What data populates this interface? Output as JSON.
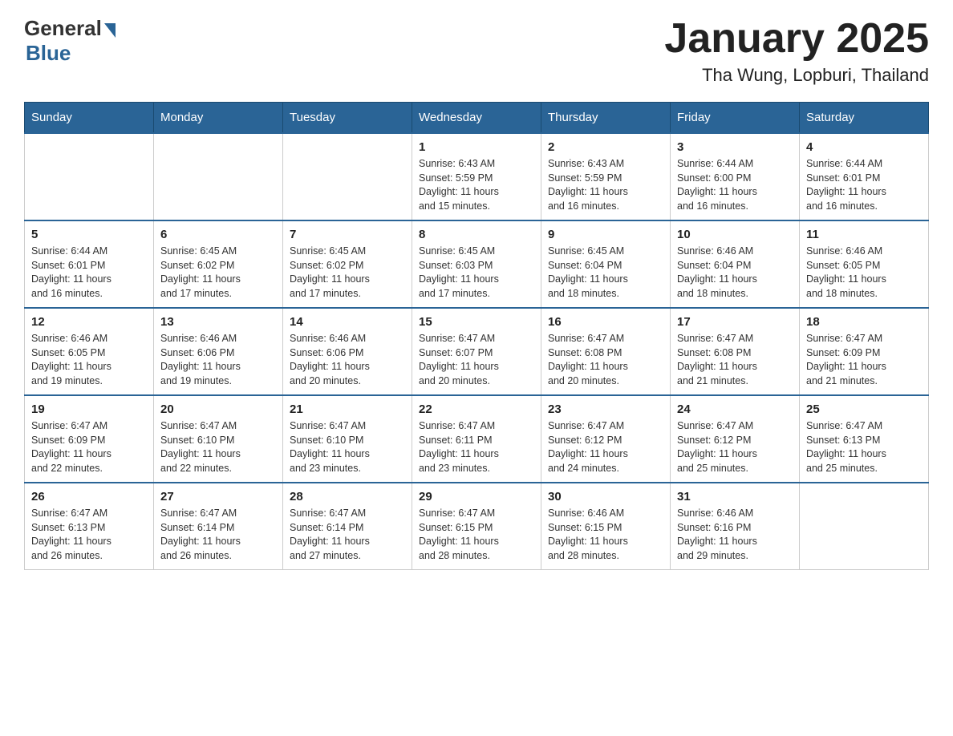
{
  "header": {
    "logo": {
      "general": "General",
      "blue": "Blue"
    },
    "title": "January 2025",
    "location": "Tha Wung, Lopburi, Thailand"
  },
  "days_header": [
    "Sunday",
    "Monday",
    "Tuesday",
    "Wednesday",
    "Thursday",
    "Friday",
    "Saturday"
  ],
  "weeks": [
    [
      {
        "num": "",
        "info": ""
      },
      {
        "num": "",
        "info": ""
      },
      {
        "num": "",
        "info": ""
      },
      {
        "num": "1",
        "info": "Sunrise: 6:43 AM\nSunset: 5:59 PM\nDaylight: 11 hours\nand 15 minutes."
      },
      {
        "num": "2",
        "info": "Sunrise: 6:43 AM\nSunset: 5:59 PM\nDaylight: 11 hours\nand 16 minutes."
      },
      {
        "num": "3",
        "info": "Sunrise: 6:44 AM\nSunset: 6:00 PM\nDaylight: 11 hours\nand 16 minutes."
      },
      {
        "num": "4",
        "info": "Sunrise: 6:44 AM\nSunset: 6:01 PM\nDaylight: 11 hours\nand 16 minutes."
      }
    ],
    [
      {
        "num": "5",
        "info": "Sunrise: 6:44 AM\nSunset: 6:01 PM\nDaylight: 11 hours\nand 16 minutes."
      },
      {
        "num": "6",
        "info": "Sunrise: 6:45 AM\nSunset: 6:02 PM\nDaylight: 11 hours\nand 17 minutes."
      },
      {
        "num": "7",
        "info": "Sunrise: 6:45 AM\nSunset: 6:02 PM\nDaylight: 11 hours\nand 17 minutes."
      },
      {
        "num": "8",
        "info": "Sunrise: 6:45 AM\nSunset: 6:03 PM\nDaylight: 11 hours\nand 17 minutes."
      },
      {
        "num": "9",
        "info": "Sunrise: 6:45 AM\nSunset: 6:04 PM\nDaylight: 11 hours\nand 18 minutes."
      },
      {
        "num": "10",
        "info": "Sunrise: 6:46 AM\nSunset: 6:04 PM\nDaylight: 11 hours\nand 18 minutes."
      },
      {
        "num": "11",
        "info": "Sunrise: 6:46 AM\nSunset: 6:05 PM\nDaylight: 11 hours\nand 18 minutes."
      }
    ],
    [
      {
        "num": "12",
        "info": "Sunrise: 6:46 AM\nSunset: 6:05 PM\nDaylight: 11 hours\nand 19 minutes."
      },
      {
        "num": "13",
        "info": "Sunrise: 6:46 AM\nSunset: 6:06 PM\nDaylight: 11 hours\nand 19 minutes."
      },
      {
        "num": "14",
        "info": "Sunrise: 6:46 AM\nSunset: 6:06 PM\nDaylight: 11 hours\nand 20 minutes."
      },
      {
        "num": "15",
        "info": "Sunrise: 6:47 AM\nSunset: 6:07 PM\nDaylight: 11 hours\nand 20 minutes."
      },
      {
        "num": "16",
        "info": "Sunrise: 6:47 AM\nSunset: 6:08 PM\nDaylight: 11 hours\nand 20 minutes."
      },
      {
        "num": "17",
        "info": "Sunrise: 6:47 AM\nSunset: 6:08 PM\nDaylight: 11 hours\nand 21 minutes."
      },
      {
        "num": "18",
        "info": "Sunrise: 6:47 AM\nSunset: 6:09 PM\nDaylight: 11 hours\nand 21 minutes."
      }
    ],
    [
      {
        "num": "19",
        "info": "Sunrise: 6:47 AM\nSunset: 6:09 PM\nDaylight: 11 hours\nand 22 minutes."
      },
      {
        "num": "20",
        "info": "Sunrise: 6:47 AM\nSunset: 6:10 PM\nDaylight: 11 hours\nand 22 minutes."
      },
      {
        "num": "21",
        "info": "Sunrise: 6:47 AM\nSunset: 6:10 PM\nDaylight: 11 hours\nand 23 minutes."
      },
      {
        "num": "22",
        "info": "Sunrise: 6:47 AM\nSunset: 6:11 PM\nDaylight: 11 hours\nand 23 minutes."
      },
      {
        "num": "23",
        "info": "Sunrise: 6:47 AM\nSunset: 6:12 PM\nDaylight: 11 hours\nand 24 minutes."
      },
      {
        "num": "24",
        "info": "Sunrise: 6:47 AM\nSunset: 6:12 PM\nDaylight: 11 hours\nand 25 minutes."
      },
      {
        "num": "25",
        "info": "Sunrise: 6:47 AM\nSunset: 6:13 PM\nDaylight: 11 hours\nand 25 minutes."
      }
    ],
    [
      {
        "num": "26",
        "info": "Sunrise: 6:47 AM\nSunset: 6:13 PM\nDaylight: 11 hours\nand 26 minutes."
      },
      {
        "num": "27",
        "info": "Sunrise: 6:47 AM\nSunset: 6:14 PM\nDaylight: 11 hours\nand 26 minutes."
      },
      {
        "num": "28",
        "info": "Sunrise: 6:47 AM\nSunset: 6:14 PM\nDaylight: 11 hours\nand 27 minutes."
      },
      {
        "num": "29",
        "info": "Sunrise: 6:47 AM\nSunset: 6:15 PM\nDaylight: 11 hours\nand 28 minutes."
      },
      {
        "num": "30",
        "info": "Sunrise: 6:46 AM\nSunset: 6:15 PM\nDaylight: 11 hours\nand 28 minutes."
      },
      {
        "num": "31",
        "info": "Sunrise: 6:46 AM\nSunset: 6:16 PM\nDaylight: 11 hours\nand 29 minutes."
      },
      {
        "num": "",
        "info": ""
      }
    ]
  ]
}
